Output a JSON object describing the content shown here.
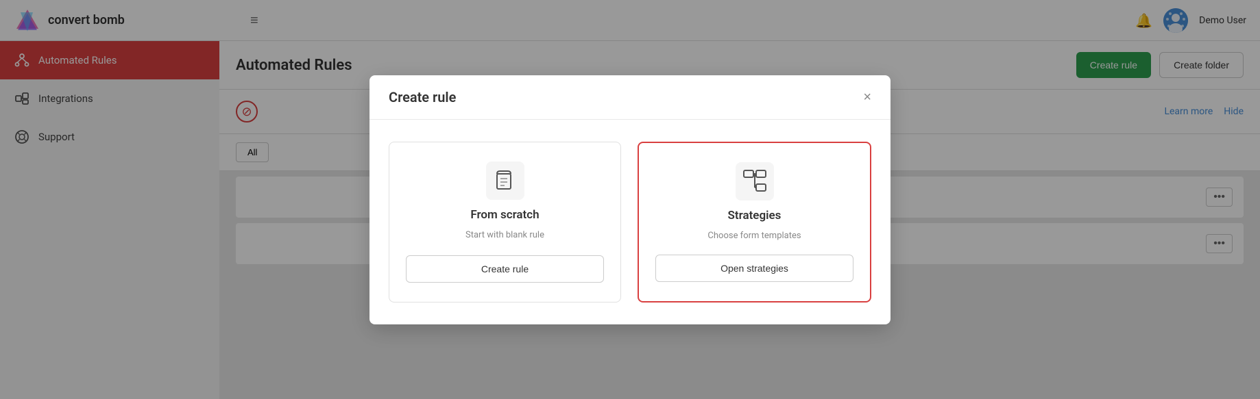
{
  "header": {
    "logo_text": "convert bomb",
    "hamburger_icon": "≡",
    "bell_icon": "🔔",
    "user_name": "Demo User"
  },
  "sidebar": {
    "items": [
      {
        "id": "automated-rules",
        "label": "Automated Rules",
        "active": true
      },
      {
        "id": "integrations",
        "label": "Integrations",
        "active": false
      },
      {
        "id": "support",
        "label": "Support",
        "active": false
      }
    ]
  },
  "content": {
    "title": "Automated Rules",
    "create_rule_label": "Create rule",
    "create_folder_label": "Create folder",
    "learn_more_label": "Learn more",
    "hide_label": "Hide",
    "filter_all_label": "All",
    "more_icon_label": "•••"
  },
  "modal": {
    "title": "Create rule",
    "close_icon": "×",
    "options": [
      {
        "id": "from-scratch",
        "icon": "🗂",
        "title": "From scratch",
        "description": "Start with blank rule",
        "action_label": "Create rule",
        "selected": false
      },
      {
        "id": "strategies",
        "icon": "⊞",
        "title": "Strategies",
        "description": "Choose form templates",
        "action_label": "Open strategies",
        "selected": true
      }
    ]
  }
}
